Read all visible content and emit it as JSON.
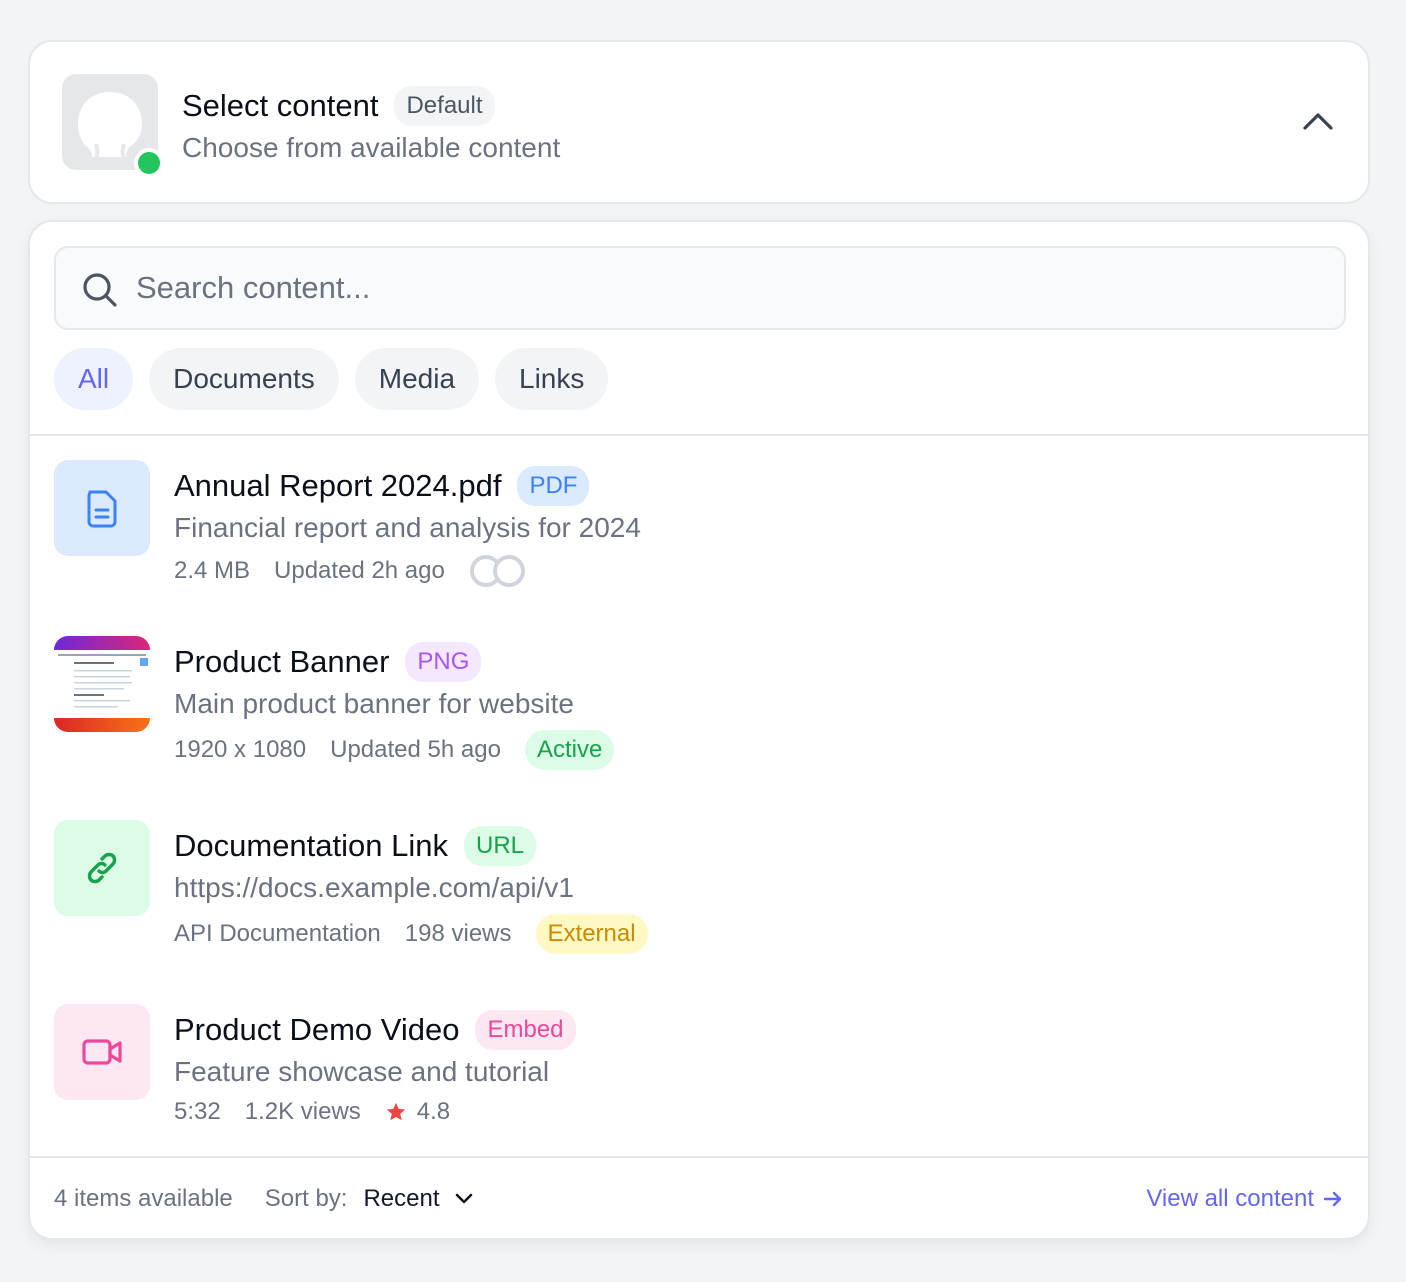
{
  "header": {
    "title": "Select content",
    "badge": "Default",
    "subtitle": "Choose from available content",
    "status_color": "#22c55e"
  },
  "search": {
    "placeholder": "Search content..."
  },
  "filters": [
    {
      "label": "All",
      "active": true
    },
    {
      "label": "Documents",
      "active": false
    },
    {
      "label": "Media",
      "active": false
    },
    {
      "label": "Links",
      "active": false
    }
  ],
  "items": [
    {
      "title": "Annual Report 2024.pdf",
      "type": "PDF",
      "description": "Financial report and analysis for 2024",
      "meta": [
        "2.4 MB",
        "Updated 2h ago"
      ],
      "icon": "document-icon"
    },
    {
      "title": "Product Banner",
      "type": "PNG",
      "description": "Main product banner for website",
      "meta": [
        "1920 x 1080",
        "Updated 5h ago"
      ],
      "status": "Active",
      "icon": "image-thumbnail"
    },
    {
      "title": "Documentation Link",
      "type": "URL",
      "description": "https://docs.example.com/api/v1",
      "meta": [
        "API Documentation",
        "198 views"
      ],
      "status": "External",
      "icon": "link-icon"
    },
    {
      "title": "Product Demo Video",
      "type": "Embed",
      "description": "Feature showcase and tutorial",
      "meta": [
        "5:32",
        "1.2K views"
      ],
      "rating": "4.8",
      "icon": "video-icon"
    }
  ],
  "footer": {
    "count": "4 items available",
    "sort_label": "Sort by:",
    "sort_value": "Recent",
    "view_all": "View all content"
  }
}
